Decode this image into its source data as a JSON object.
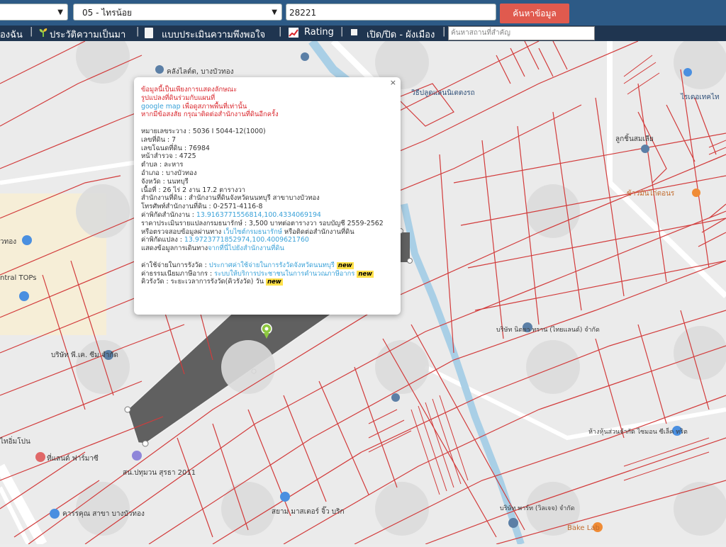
{
  "toolbar": {
    "select_1": "",
    "select_2": "05 - ไทรน้อย",
    "parcel_value": "28221",
    "search_label": "ค้นหาข้อมูล"
  },
  "nav": {
    "item_1": "องฉัน",
    "item_2": "ประวัติความเป็นมา",
    "item_3": "แบบประเมินความพึงพอใจ",
    "item_4": "Rating",
    "item_5": "เปิด/ปิด - ผังเมือง",
    "place_placeholder": "ค้นหาสถานที่สำคัญ"
  },
  "map_labels": {
    "l1": "คลังไลต์ต, บางบัวทอง",
    "l2": "วิธีปลูดแลนนิเตตงรถ",
    "l3": "ลูกชิ้นสมเลีย",
    "l4": "ข้าวมันไก่ตอนร",
    "l5": "ntral TOPs",
    "l6": "ัวทอง",
    "l7": "บริษัท นิตยา ทราน (ไทยแลนด์) จำกัด",
    "l8": "ห้างหุ้นส่วนจำกัด ไซมอน ซีเล็ค ทริต",
    "l9": "ที่แลนด์ ฟาร์มาซี",
    "l10": "สน.ปทุมวน สุรธา 2011",
    "l11": "สยาม มาสเตอร์ จิ๊ว บริก",
    "l12": "ไทอิ่มโปน",
    "l13": "บริษัท พี.เค. ซีม จำกัด",
    "l14": "Bake Lab",
    "l15": "บริษัท พาร์ท (วิลเจจ) จำกัด",
    "l16": "คารรคุณ สาขา บางบัวทอง",
    "l17": "ไรเดอเทคไท"
  },
  "popup": {
    "close": "×",
    "notice_1": "ข้อมูลนี้เป็นเพียงการแสดงลักษณะ",
    "notice_2": "รูปแปลงที่ดินร่วมกับแผนที่",
    "notice_3a": "google map",
    "notice_3b": " เพื่อดูสภาพพื้นที่เท่านั้น",
    "notice_4": "หากมีข้อสงสัย กรุณาติดต่อสำนักงานที่ดินอีกครั้ง",
    "row_1": "หมายเลขระวาง : 5036 I 5044-12(1000)",
    "row_2": "เลขที่ดิน : 7",
    "row_3": "เลขโฉนดที่ดิน : 76984",
    "row_4": "หน้าสำรวจ : 4725",
    "row_5": "ตำบล : ละหาร",
    "row_6": "อำเภอ : บางบัวทอง",
    "row_7": "จังหวัด : นนทบุรี",
    "row_8": "เนื้อที่ : 26 ไร่ 2 งาน 17.2 ตารางวา",
    "row_9": "สำนักงานที่ดิน : สำนักงานที่ดินจังหวัดนนทบุรี สาขาบางบัวทอง",
    "row_10": "โทรศัพท์สำนักงานที่ดิน : 0-2571-4116-8",
    "row_11a": "ค่าพิกัดสำนักงาน : ",
    "row_11b": "13.9163771556814,100.4334069194",
    "row_12": "ราคาประเมินรายแปลงกรมธนารักษ์ : 3,500 บาทต่อตารางวา รอบบัญชี 2559-2562",
    "row_13a": "หรือตรวจสอบข้อมูลผ่านทาง ",
    "row_13b": "เว็บไซต์กรมธนารักษ์",
    "row_13c": " หรือติดต่อสำนักงานที่ดิน",
    "row_14a": "ค่าพิกัดแปลง : ",
    "row_14b": "13.9723771852974,100.4009621760",
    "row_15a": "แสดงข้อมูลการเดินทาง",
    "row_15b": "จากที่นี่ไปยังสำนักงานที่ดิน",
    "row_16a": "ค่าใช้จ่ายในการรังวัด : ",
    "row_16b": "ประกาศค่าใช้จ่ายในการรังวัดจังหวัดนนทบุรี",
    "row_17a": "ค่าธรรมเนียมภาษีอากร : ",
    "row_17b": "ระบบให้บริการประชาชนในการคำนวณภาษีอากร",
    "row_18": "คิวรังวัด : ระยะเวลาการรังวัด(คิวรังวัด) วัน",
    "new_badge": "new"
  }
}
